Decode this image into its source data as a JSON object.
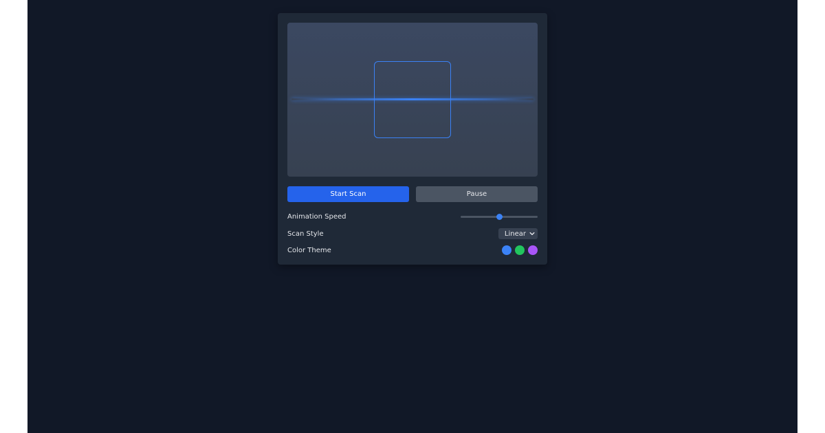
{
  "controls": {
    "start_label": "Start Scan",
    "pause_label": "Pause"
  },
  "settings": {
    "speed": {
      "label": "Animation Speed",
      "value_fraction": 0.5
    },
    "style": {
      "label": "Scan Style",
      "selected": "Linear"
    },
    "theme": {
      "label": "Color Theme",
      "options": [
        {
          "name": "blue",
          "color": "#3b82f6"
        },
        {
          "name": "green",
          "color": "#22c55e"
        },
        {
          "name": "purple",
          "color": "#a855f7"
        }
      ]
    }
  },
  "colors": {
    "accent": "#2563eb",
    "scan": "#3b82f6",
    "secondary_button": "#4b5563"
  },
  "icons": {
    "select_chevron": "chevron-down-icon"
  }
}
